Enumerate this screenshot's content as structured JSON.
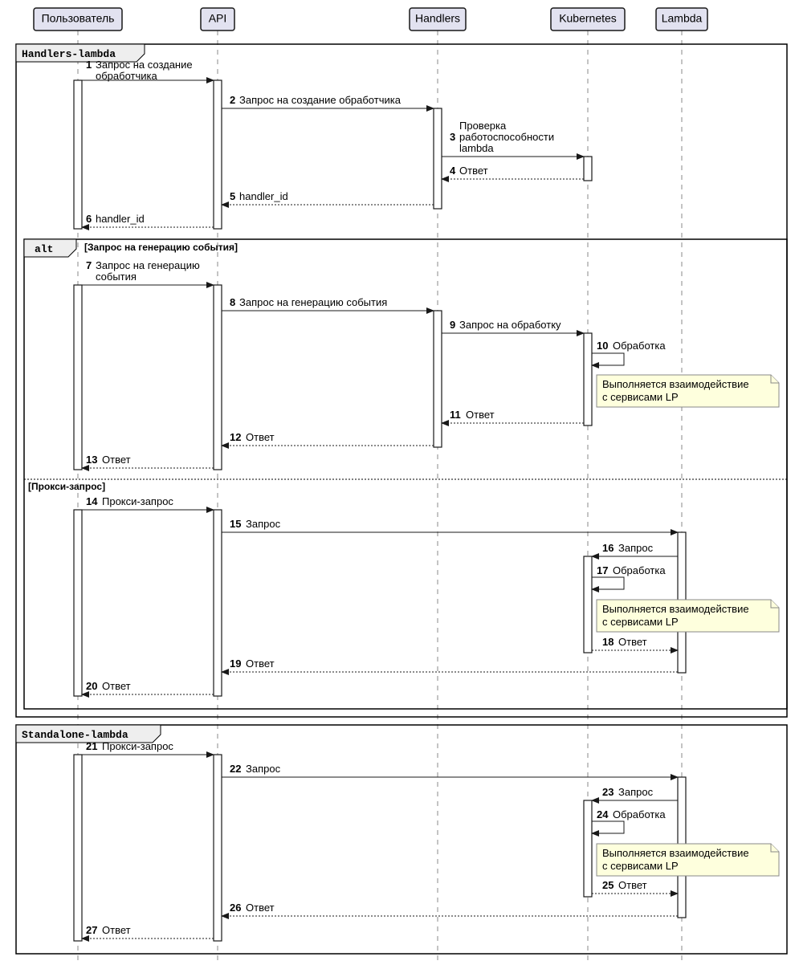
{
  "participants": {
    "user": "Пользователь",
    "api": "API",
    "handlers": "Handlers",
    "kubernetes": "Kubernetes",
    "lambda": "Lambda"
  },
  "frames": {
    "handlers_lambda": "Handlers-lambda",
    "alt": "alt",
    "alt_guard1": "[Запрос на генерацию события]",
    "alt_guard2": "[Прокси-запрос]",
    "standalone_lambda": "Standalone-lambda"
  },
  "messages": {
    "m1": {
      "n": "1",
      "t1": "Запрос на создание",
      "t2": "обработчика"
    },
    "m2": {
      "n": "2",
      "t": "Запрос на создание обработчика"
    },
    "m3": {
      "n": "3",
      "t1": "Проверка",
      "t2": "работоспособности",
      "t3": "lambda"
    },
    "m4": {
      "n": "4",
      "t": "Ответ"
    },
    "m5": {
      "n": "5",
      "t": "handler_id"
    },
    "m6": {
      "n": "6",
      "t": "handler_id"
    },
    "m7": {
      "n": "7",
      "t1": "Запрос на генерацию",
      "t2": "события"
    },
    "m8": {
      "n": "8",
      "t": "Запрос на генерацию события"
    },
    "m9": {
      "n": "9",
      "t": "Запрос на обработку"
    },
    "m10": {
      "n": "10",
      "t": "Обработка"
    },
    "m11": {
      "n": "11",
      "t": "Ответ"
    },
    "m12": {
      "n": "12",
      "t": "Ответ"
    },
    "m13": {
      "n": "13",
      "t": "Ответ"
    },
    "m14": {
      "n": "14",
      "t": "Прокси-запрос"
    },
    "m15": {
      "n": "15",
      "t": "Запрос"
    },
    "m16": {
      "n": "16",
      "t": "Запрос"
    },
    "m17": {
      "n": "17",
      "t": "Обработка"
    },
    "m18": {
      "n": "18",
      "t": "Ответ"
    },
    "m19": {
      "n": "19",
      "t": "Ответ"
    },
    "m20": {
      "n": "20",
      "t": "Ответ"
    },
    "m21": {
      "n": "21",
      "t": "Прокси-запрос"
    },
    "m22": {
      "n": "22",
      "t": "Запрос"
    },
    "m23": {
      "n": "23",
      "t": "Запрос"
    },
    "m24": {
      "n": "24",
      "t": "Обработка"
    },
    "m25": {
      "n": "25",
      "t": "Ответ"
    },
    "m26": {
      "n": "26",
      "t": "Ответ"
    },
    "m27": {
      "n": "27",
      "t": "Ответ"
    }
  },
  "notes": {
    "n1": {
      "l1": "Выполняется взаимодействие",
      "l2": "с сервисами LP"
    },
    "n2": {
      "l1": "Выполняется взаимодействие",
      "l2": "с сервисами LP"
    },
    "n3": {
      "l1": "Выполняется взаимодействие",
      "l2": "с сервисами LP"
    }
  }
}
